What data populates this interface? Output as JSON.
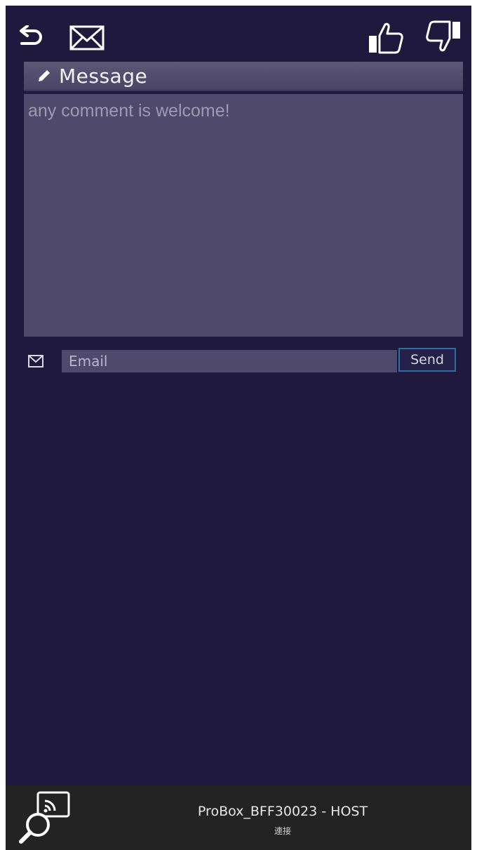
{
  "topbar": {
    "icons": [
      "back-arrow-icon",
      "envelope-icon",
      "thumbs-up-icon",
      "thumbs-down-icon"
    ]
  },
  "message": {
    "title": "Message",
    "placeholder": "any comment is welcome!"
  },
  "email": {
    "placeholder": "Email",
    "send_label": "Send"
  },
  "bottombar": {
    "device_name": "ProBox_BFF30023 - HOST",
    "status": "連接"
  },
  "colors": {
    "background": "#1f1a3d",
    "panel": "#4f4a6b",
    "header": "#5c5776",
    "send_border": "#2b6ea0",
    "bottom_bar": "#232323"
  }
}
